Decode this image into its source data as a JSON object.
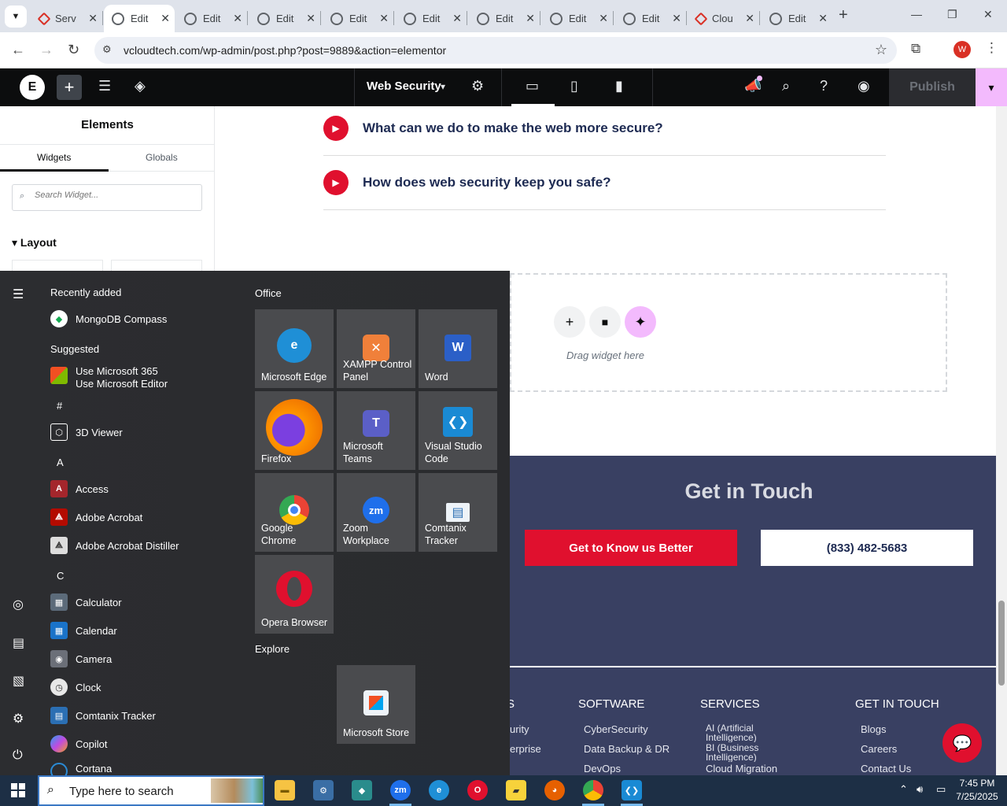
{
  "browser": {
    "tabs": [
      {
        "label": "Serv",
        "type": "red"
      },
      {
        "label": "Edit",
        "type": "globe",
        "active": true
      },
      {
        "label": "Edit",
        "type": "globe"
      },
      {
        "label": "Edit",
        "type": "globe"
      },
      {
        "label": "Edit",
        "type": "globe"
      },
      {
        "label": "Edit",
        "type": "globe"
      },
      {
        "label": "Edit",
        "type": "globe"
      },
      {
        "label": "Edit",
        "type": "globe"
      },
      {
        "label": "Edit",
        "type": "globe"
      },
      {
        "label": "Clou",
        "type": "red"
      },
      {
        "label": "Edit",
        "type": "globe"
      }
    ],
    "url": "vcloudtech.com/wp-admin/post.php?post=9889&action=elementor",
    "profile_initial": "W"
  },
  "elementor": {
    "document_name": "Web Security",
    "publish_label": "Publish"
  },
  "panel": {
    "title": "Elements",
    "tab_widgets": "Widgets",
    "tab_globals": "Globals",
    "search_placeholder": "Search Widget...",
    "section_layout": "Layout"
  },
  "canvas": {
    "faq": [
      "What can we do to make the web more secure?",
      "How does web security keep you safe?"
    ],
    "drop_hint": "Drag widget here",
    "contact_heading": "Get in Touch",
    "cta_label": "Get to Know us Better",
    "phone": "(833) 482-5683",
    "footer": {
      "partial_col_header": "S",
      "partial_links": [
        "urity",
        "erprise"
      ],
      "software_header": "SOFTWARE",
      "software_links": [
        "CyberSecurity",
        "Data Backup & DR",
        "DevOps"
      ],
      "services_header": "SERVICES",
      "services_links": [
        "AI (Artificial Intelligence)",
        "BI (Business Intelligence)",
        "Cloud Migration"
      ],
      "contact_header": "GET IN TOUCH",
      "contact_links": [
        "Blogs",
        "Careers",
        "Contact Us"
      ]
    }
  },
  "start_menu": {
    "recently_added": "Recently added",
    "recent_app": "MongoDB Compass",
    "suggested": "Suggested",
    "suggested_line1": "Use Microsoft 365",
    "suggested_line2": "Use Microsoft Editor",
    "letters": [
      "#",
      "A",
      "C"
    ],
    "apps": [
      "3D Viewer",
      "Access",
      "Adobe Acrobat",
      "Adobe Acrobat Distiller",
      "Calculator",
      "Calendar",
      "Camera",
      "Clock",
      "Comtanix Tracker",
      "Copilot",
      "Cortana"
    ],
    "group_office": "Office",
    "group_explore": "Explore",
    "tiles": [
      {
        "label": "Microsoft Edge",
        "color": "#1f8fd6"
      },
      {
        "label": "XAMPP Control Panel",
        "color": "#f0803a"
      },
      {
        "label": "Word",
        "color": "#2b5fc7"
      },
      {
        "label": "Firefox",
        "color": "#e66000"
      },
      {
        "label": "Microsoft Teams",
        "color": "#5b5fc7"
      },
      {
        "label": "Visual Studio Code",
        "color": "#1a8ad4"
      },
      {
        "label": "Google Chrome",
        "color": "#34a853"
      },
      {
        "label": "Zoom Workplace",
        "color": "#1f6feb"
      },
      {
        "label": "Comtanix Tracker",
        "color": "#2b6fb3"
      },
      {
        "label": "Opera Browser",
        "color": "#e0102e"
      },
      {
        "label": "Microsoft Store",
        "color": "#2b6fb3"
      }
    ]
  },
  "taskbar": {
    "search_placeholder": "Type here to search",
    "time": "7:45 PM",
    "date": "7/25/2025"
  }
}
